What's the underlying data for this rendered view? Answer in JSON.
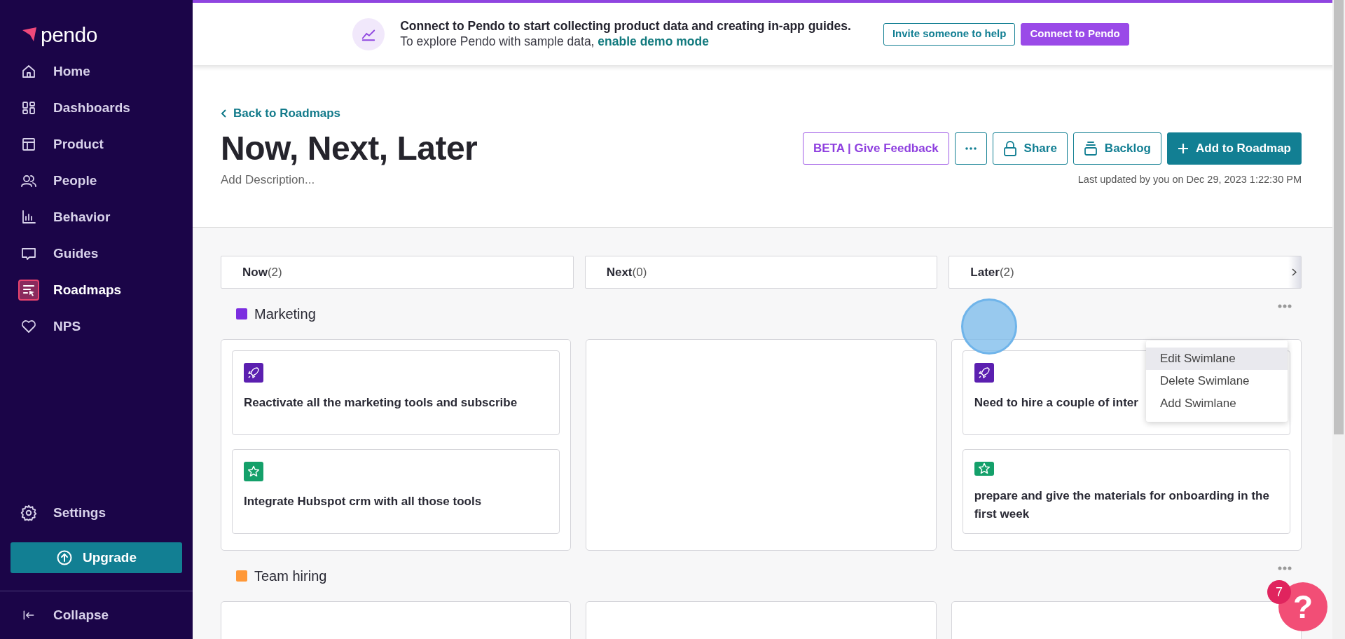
{
  "sidebar": {
    "logo": "pendo",
    "items": [
      {
        "label": "Home",
        "kind": "home",
        "selected": false
      },
      {
        "label": "Dashboards",
        "kind": "dashboards",
        "selected": false
      },
      {
        "label": "Product",
        "kind": "product",
        "selected": false
      },
      {
        "label": "People",
        "kind": "people",
        "selected": false
      },
      {
        "label": "Behavior",
        "kind": "behavior",
        "selected": false
      },
      {
        "label": "Guides",
        "kind": "guides",
        "selected": false
      },
      {
        "label": "Roadmaps",
        "kind": "roadmaps",
        "selected": true
      },
      {
        "label": "NPS",
        "kind": "nps",
        "selected": false
      }
    ],
    "settings": "Settings",
    "upgrade": "Upgrade",
    "collapse": "Collapse"
  },
  "banner": {
    "title": "Connect to Pendo to start collecting product data and creating in-app guides.",
    "text": "To explore Pendo with sample data, ",
    "link": "enable demo mode",
    "buttons": [
      {
        "label": "Invite someone to help",
        "kind": "outline"
      },
      {
        "label": "Connect to Pendo",
        "kind": "primary"
      }
    ]
  },
  "header": {
    "back_link": "Back to Roadmaps",
    "title": "Now, Next, Later",
    "description": {
      "placeholder": "Add Description..."
    },
    "actions": [
      {
        "label": "BETA | Give Feedback",
        "kind": "feedback"
      },
      {
        "kind": "more"
      },
      {
        "label": "Share",
        "kind": "share"
      },
      {
        "label": "Backlog",
        "kind": "backlog"
      },
      {
        "label": "Add to Roadmap",
        "kind": "add"
      }
    ],
    "last_updated": "Last updated by you on Dec 29, 2023 1:22:30 PM"
  },
  "columns": [
    {
      "name": "Now",
      "count": "(2)"
    },
    {
      "name": "Next",
      "count": "(0)"
    },
    {
      "name": "Later",
      "count": "(2)"
    }
  ],
  "swimlanes": [
    {
      "name": "Marketing",
      "color": "#7b2ee0",
      "cells": [
        [
          {
            "kind": "rocket",
            "text": "Reactivate all the marketing tools and subscribe"
          },
          {
            "kind": "star",
            "text": "Integrate Hubspot crm with all those tools"
          }
        ],
        [],
        [
          {
            "kind": "rocket",
            "text": "Need to hire a couple of inter"
          },
          {
            "kind": "star",
            "text": "prepare and give the materials for onboarding in the first week"
          }
        ]
      ]
    },
    {
      "name": "Team hiring",
      "color": "#ff9838",
      "cells": [
        [],
        [],
        []
      ]
    }
  ],
  "context_menu": {
    "items": [
      {
        "label": "Edit Swimlane",
        "selected": true
      },
      {
        "label": "Delete Swimlane",
        "selected": false
      },
      {
        "label": "Add Swimlane",
        "selected": false
      }
    ]
  },
  "help": {
    "label": "?",
    "badge": "7"
  }
}
